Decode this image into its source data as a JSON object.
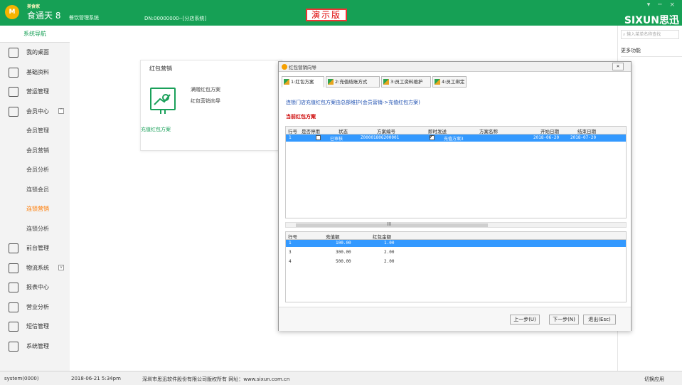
{
  "header": {
    "logo_small": "美食家",
    "app_name": "食通天 8",
    "app_sub": "餐饮管理系统",
    "dn": "DN:00000000--[分店系统]",
    "demo_label": "演示版",
    "brand": "SIXUN思迅",
    "win_controls": "▾ ─ ×",
    "brand_color": "#16a055"
  },
  "sidebar": {
    "head": "系统导航",
    "items": [
      {
        "label": "我的桌面",
        "icon": "home-icon"
      },
      {
        "label": "基础资料",
        "icon": "document-icon"
      },
      {
        "label": "营运管理",
        "icon": "chart-icon"
      },
      {
        "label": "会员中心",
        "icon": "member-icon",
        "chevron": "^"
      },
      {
        "label": "会员管理",
        "sub": true
      },
      {
        "label": "会员营销",
        "sub": true
      },
      {
        "label": "会员分析",
        "sub": true
      },
      {
        "label": "连锁会员",
        "sub": true
      },
      {
        "label": "连锁营销",
        "sub": true,
        "active": true
      },
      {
        "label": "连锁分析",
        "sub": true
      },
      {
        "label": "前台管理",
        "icon": "pos-icon"
      },
      {
        "label": "物流系统",
        "icon": "cart-icon",
        "chevron": "v"
      },
      {
        "label": "报表中心",
        "icon": "report-icon"
      },
      {
        "label": "营业分析",
        "icon": "pie-icon"
      },
      {
        "label": "短信管理",
        "icon": "mail-icon"
      },
      {
        "label": "系统管理",
        "icon": "settings-icon"
      }
    ]
  },
  "right": {
    "search_placeholder": "输入菜单名称查找",
    "more": "更多功能"
  },
  "card": {
    "title": "红包营销",
    "link1": "满赠红包方案",
    "link2": "红包营销向导",
    "caption": "充值红包方案"
  },
  "dialog": {
    "title": "红包营销向导",
    "close": "✕",
    "tabs": [
      "1:红包方案",
      "2:充值结账方式",
      "3:员工资料维护",
      "4:员工绑定"
    ],
    "info": "连锁门店充值红包方案由总部维护(会员营销->充值红包方案)",
    "section": "当前红包方案",
    "grid1_headers": [
      "行号",
      "是否停用",
      "状态",
      "方案编号",
      "即时发送",
      "方案名称",
      "开始日期",
      "结束日期"
    ],
    "grid1_rows": [
      {
        "no": "1",
        "disabled": false,
        "status": "已审核",
        "code": "Z00001806200001",
        "instant": true,
        "name": "充值方案3",
        "start": "2018-06-20",
        "end": "2018-07-20"
      }
    ],
    "scroll_dots": "III",
    "grid2_headers": [
      "行号",
      "充值额",
      "红包金额"
    ],
    "grid2_rows": [
      {
        "no": "1",
        "amount": "100.00",
        "bonus": "1.00"
      },
      {
        "no": "3",
        "amount": "300.00",
        "bonus": "2.00"
      },
      {
        "no": "4",
        "amount": "500.00",
        "bonus": "2.00"
      }
    ],
    "btn_prev": "上一步(U)",
    "btn_next": "下一步(N)",
    "btn_exit": "退出(Esc)"
  },
  "status": {
    "user": "system(0000)",
    "datetime": "2018-06-21 5:34pm",
    "copyright": "深圳市思迅软件股份有限公司版权所有 网址：www.sixun.com.cn",
    "switch": "切换应用"
  }
}
